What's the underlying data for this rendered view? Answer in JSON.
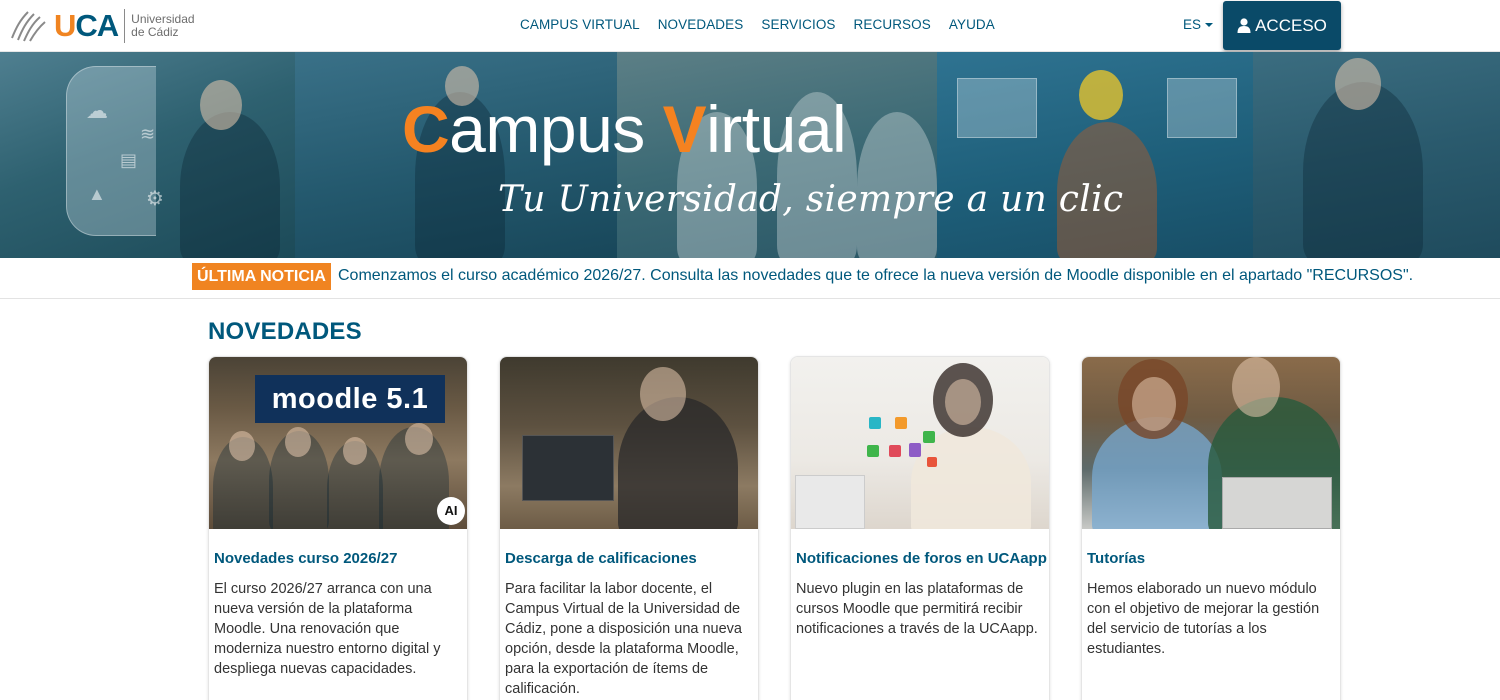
{
  "header": {
    "logo": {
      "brand": "UCA",
      "sub_line1": "Universidad",
      "sub_line2": "de Cádiz"
    },
    "nav": [
      {
        "label": "CAMPUS VIRTUAL"
      },
      {
        "label": "NOVEDADES"
      },
      {
        "label": "SERVICIOS"
      },
      {
        "label": "RECURSOS"
      },
      {
        "label": "AYUDA"
      }
    ],
    "language": "ES",
    "access_button": "ACCESO"
  },
  "banner": {
    "title_first_letter": "C",
    "title_part1": "ampus ",
    "title_second_letter": "V",
    "title_part2": "irtual",
    "subtitle": "Tu Universidad, siempre a un clic"
  },
  "ticker": {
    "badge": "ÚLTIMA NOTICIA",
    "text": "Comenzamos el curso académico 2026/27. Consulta las novedades que te ofrece la nueva versión de Moodle disponible en el apartado \"RECURSOS\"."
  },
  "novedades": {
    "title": "NOVEDADES",
    "cards": [
      {
        "image_sign": "moodle 5.1",
        "image_badge": "AI",
        "title": "Novedades curso 2026/27",
        "body": "El curso 2026/27 arranca con una nueva versión de la plataforma Moodle. Una renovación que moderniza nuestro entorno digital y despliega nuevas capacidades."
      },
      {
        "title": "Descarga de calificaciones",
        "body": "Para facilitar la labor docente, el Campus Virtual de la Universidad de Cádiz, pone a disposición una nueva opción, desde la plataforma Moodle, para la exportación de ítems de calificación."
      },
      {
        "title": "Notificaciones de foros en UCAapp",
        "body": "Nuevo plugin en las plataformas de cursos Moodle que permitirá recibir notificaciones a través de la UCAapp."
      },
      {
        "title": "Tutorías",
        "body": "Hemos elaborado un nuevo módulo con el objetivo de mejorar la gestión del servicio de tutorías a los estudiantes."
      }
    ]
  },
  "colors": {
    "brand_blue": "#00587c",
    "brand_orange": "#f08421",
    "access_bg": "#0a4a68"
  }
}
